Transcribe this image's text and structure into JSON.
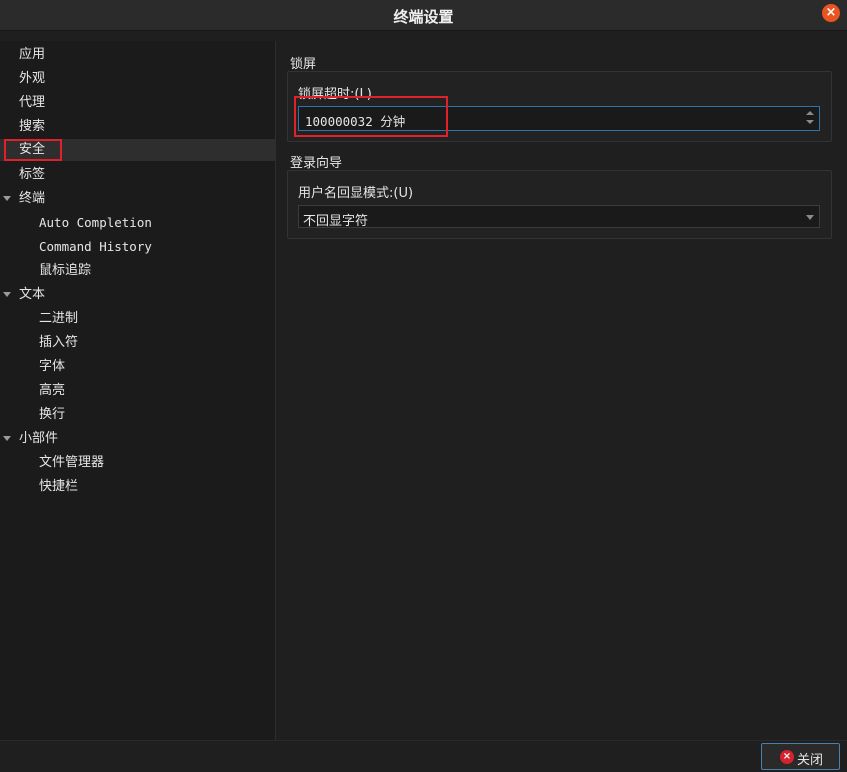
{
  "window": {
    "title": "终端设置",
    "close_glyph": "×"
  },
  "sidebar": {
    "items": [
      {
        "label": "应用"
      },
      {
        "label": "外观"
      },
      {
        "label": "代理"
      },
      {
        "label": "搜索"
      },
      {
        "label": "安全"
      },
      {
        "label": "标签"
      },
      {
        "label": "终端"
      },
      {
        "label": "Auto Completion"
      },
      {
        "label": "Command History"
      },
      {
        "label": "鼠标追踪"
      },
      {
        "label": "文本"
      },
      {
        "label": "二进制"
      },
      {
        "label": "插入符"
      },
      {
        "label": "字体"
      },
      {
        "label": "高亮"
      },
      {
        "label": "换行"
      },
      {
        "label": "小部件"
      },
      {
        "label": "文件管理器"
      },
      {
        "label": "快捷栏"
      }
    ],
    "selected": "安全"
  },
  "lock": {
    "section_title": "锁屏",
    "timeout_label": "锁屏超时:(L)",
    "timeout_value": "100000032 分钟"
  },
  "login": {
    "section_title": "登录向导",
    "echo_label": "用户名回显模式:(U)",
    "echo_value": "不回显字符"
  },
  "footer": {
    "close_label": "关闭",
    "close_glyph": "×"
  },
  "colors": {
    "accent": "#e95420",
    "highlight_box": "#e0202a",
    "focus_border": "#2f74a8"
  }
}
